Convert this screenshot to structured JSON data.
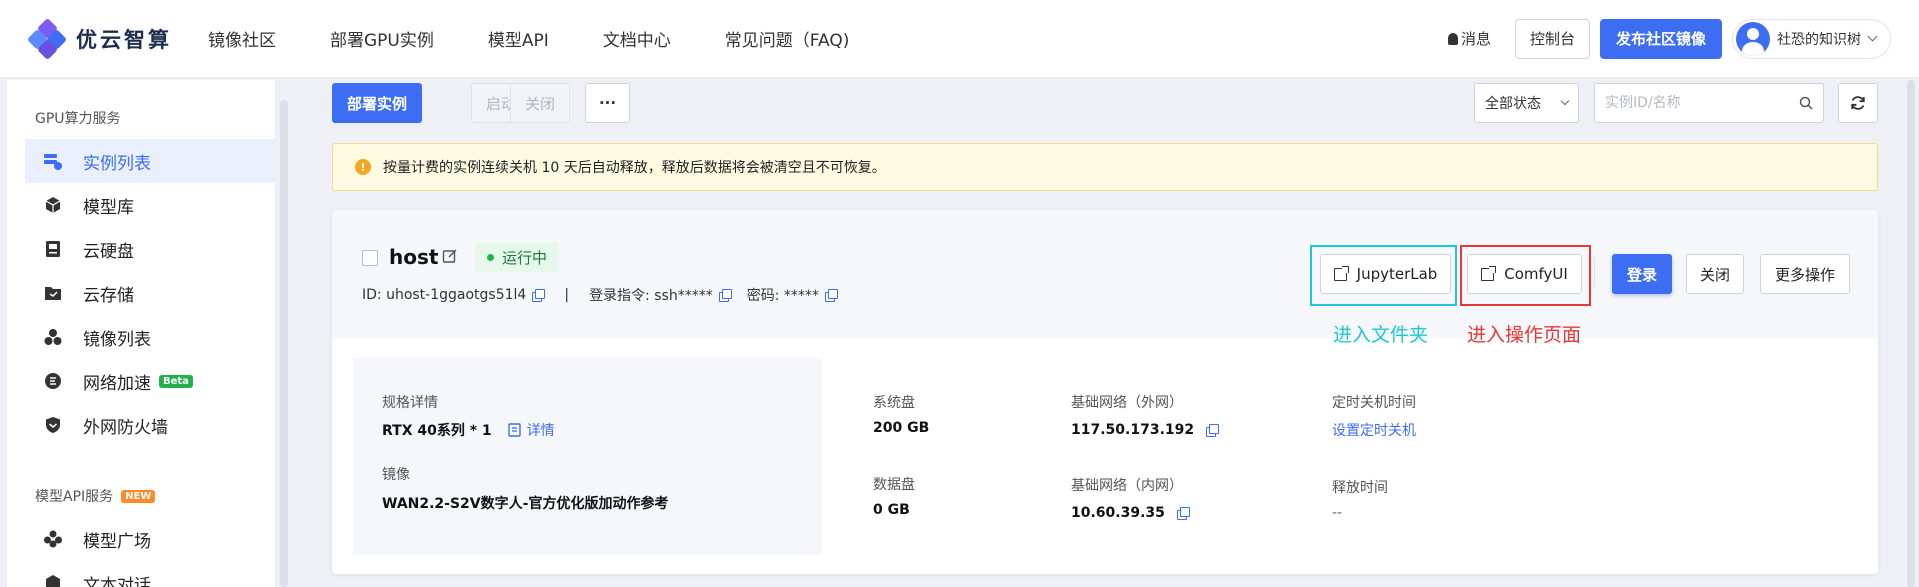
{
  "brand": {
    "name": "优云智算"
  },
  "nav": {
    "items": [
      "镜像社区",
      "部署GPU实例",
      "模型API",
      "文档中心",
      "常见问题（FAQ)"
    ]
  },
  "header": {
    "messages": "消息",
    "console": "控制台",
    "publish": "发布社区镜像",
    "username": "社恐的知识树"
  },
  "sidebar": {
    "gpu_section": "GPU算力服务",
    "items": [
      {
        "label": "实例列表",
        "icon": "instance-list-icon"
      },
      {
        "label": "模型库",
        "icon": "cube-icon"
      },
      {
        "label": "云硬盘",
        "icon": "disk-icon"
      },
      {
        "label": "云存储",
        "icon": "folder-icon"
      },
      {
        "label": "镜像列表",
        "icon": "images-icon"
      },
      {
        "label": "网络加速",
        "icon": "speed-icon",
        "badge": "Beta"
      },
      {
        "label": "外网防火墙",
        "icon": "shield-icon"
      }
    ],
    "api_section": "模型API服务",
    "api_badge": "NEW",
    "api_items": [
      {
        "label": "模型广场",
        "icon": "models-icon"
      },
      {
        "label": "文本对话",
        "icon": "chat-icon"
      }
    ]
  },
  "toolbar": {
    "deploy": "部署实例",
    "start": "启动",
    "stop": "关闭",
    "more": "···",
    "status_filter": "全部状态",
    "search_placeholder": "实例ID/名称"
  },
  "notice": "按量计费的实例连续关机 10 天后自动释放，释放后数据将会被清空且不可恢复。",
  "instance": {
    "name": "host",
    "status": "运行中",
    "id_text": "ID: uhost-1ggaotgs51l4",
    "login_cmd": "登录指令: ssh*****",
    "password": "密码: *****",
    "buttons": {
      "jupyter": "JupyterLab",
      "comfy": "ComfyUI",
      "login": "登录",
      "close": "关闭",
      "more": "更多操作"
    },
    "annotations": {
      "jupyter": "进入文件夹",
      "comfy": "进入操作页面"
    },
    "spec_label": "规格详情",
    "spec_value": "RTX 40系列 * 1",
    "spec_link": "详情",
    "image_label": "镜像",
    "image_value": "WAN2.2-S2V数字人-官方优化版加动作参考",
    "sys_disk_label": "系统盘",
    "sys_disk_value": "200 GB",
    "data_disk_label": "数据盘",
    "data_disk_value": "0 GB",
    "ext_net_label": "基础网络（外网）",
    "ext_net_value": "117.50.173.192",
    "int_net_label": "基础网络（内网）",
    "int_net_value": "10.60.39.35",
    "shutdown_label": "定时关机时间",
    "shutdown_link": "设置定时关机",
    "release_label": "释放时间",
    "release_value": "--"
  },
  "colors": {
    "primary": "#3d6df2",
    "cyan_highlight": "#1ec8d2",
    "red_highlight": "#e53935",
    "running": "#23b24c"
  }
}
